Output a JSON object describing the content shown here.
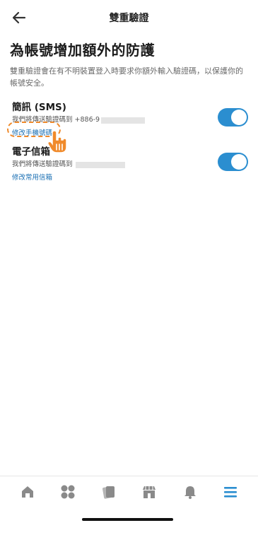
{
  "header": {
    "title": "雙重驗證"
  },
  "page": {
    "title": "為帳號增加額外的防護",
    "description": "雙重驗證會在有不明裝置登入時要求你額外輸入驗證碼，以保護你的帳號安全。"
  },
  "sms": {
    "title": "簡訊 (SMS)",
    "subtitle": "我們將傳送驗證碼到 +886-9",
    "link": "修改手機號碼",
    "enabled": true
  },
  "email": {
    "title": "電子信箱",
    "subtitle": "我們將傳送驗證碼到",
    "link": "修改常用信箱",
    "enabled": true
  },
  "tabbar": {
    "items": [
      {
        "icon": "home-icon"
      },
      {
        "icon": "grid-icon"
      },
      {
        "icon": "cards-icon"
      },
      {
        "icon": "store-icon"
      },
      {
        "icon": "bell-icon"
      },
      {
        "icon": "menu-icon",
        "active": true
      }
    ]
  },
  "colors": {
    "toggle_on": "#2b8ed0",
    "link": "#1a6fb3",
    "highlight": "#f08a2b",
    "tab_inactive": "#8a8a8a",
    "tab_active": "#2b8ed0"
  }
}
